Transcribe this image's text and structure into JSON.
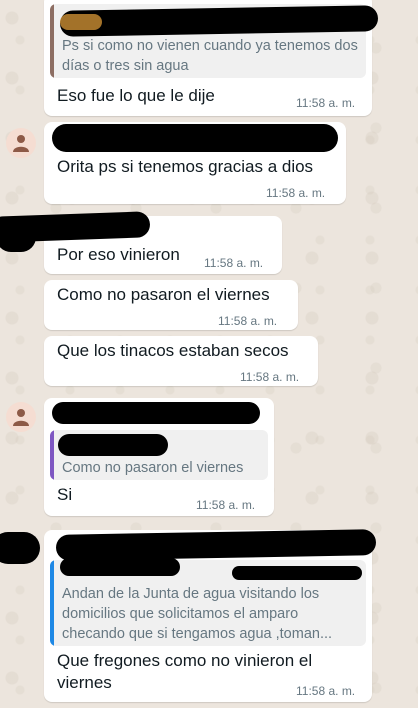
{
  "theme": {
    "bubble_color": "#ffffff",
    "chat_background": "#ece5dd",
    "quote_bar_colors": {
      "brown": "#8d6e63",
      "purple": "#7e57c2",
      "blue": "#1e88e5"
    }
  },
  "messages": [
    {
      "quote": "Ps si como no vienen cuando ya tenemos dos días o tres sin agua",
      "text": "Eso fue lo que le dije",
      "time": "11:58 a. m."
    },
    {
      "text": "Orita ps si tenemos gracias a dios",
      "time": "11:58 a. m."
    },
    {
      "text": "Por eso vinieron",
      "time": "11:58 a. m."
    },
    {
      "text": "Como no pasaron el viernes",
      "time": "11:58 a. m."
    },
    {
      "text": "Que los tinacos estaban secos",
      "time": "11:58 a. m."
    },
    {
      "quote": "Como no pasaron el viernes",
      "text": "Si",
      "time": "11:58 a. m."
    },
    {
      "quote": "Andan de la Junta de agua visitando los domicilios que solicitamos el amparo checando que si tengamos agua ,toman...",
      "text": "Que fregones como no vinieron el viernes",
      "time": "11:58 a. m."
    }
  ]
}
